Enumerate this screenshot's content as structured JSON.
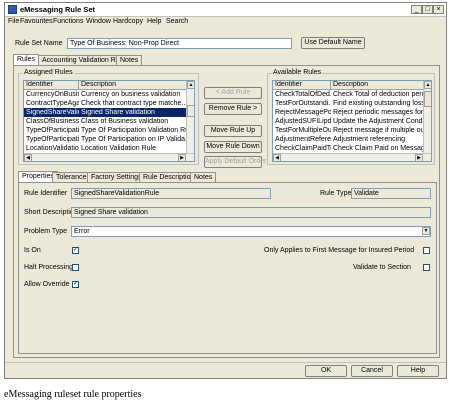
{
  "window": {
    "title": "eMessaging Rule Set",
    "minimize": "_",
    "maximize": "□",
    "close": "×"
  },
  "menu": [
    "File",
    "Favourites",
    "Functions",
    "Window",
    "Hardcopy",
    "Help",
    "Search"
  ],
  "rule_set": {
    "label": "Rule Set Name",
    "value": "Type Of Business: Non-Prop Direct",
    "use_default": "Use Default Name"
  },
  "top_tabs": [
    "Rules",
    "Accounting Validation Rules",
    "Notes"
  ],
  "assigned": {
    "title": "Assigned Rules",
    "headers": [
      "Identifier",
      "Description"
    ],
    "rows": [
      [
        "CurrencyOnBusin...",
        "Currency on business validation"
      ],
      [
        "ContractTypeAgai...",
        "Check that contract type matche..."
      ],
      [
        "SignedShareValida...",
        "Signed Share validation"
      ],
      [
        "ClassOfBusinessO...",
        "Class of Business validation"
      ],
      [
        "TypeOfParticipati...",
        "Type Of Participation Validation Rule"
      ],
      [
        "TypeOfParticipati...",
        "Type Of Participation on IP Valida..."
      ],
      [
        "LocationValidation",
        "Location Validation Rule"
      ]
    ],
    "selected_index": 2
  },
  "actions": {
    "add": "< Add Rule",
    "remove": "Remove Rule >",
    "up": "Move Rule Up",
    "down": "Move Rule Down",
    "apply": "Apply Default Order"
  },
  "available": {
    "title": "Available Rules",
    "headers": [
      "Identifier",
      "Description"
    ],
    "rows": [
      [
        "CheckTotalOfDed...",
        "Check Total of deduction percen"
      ],
      [
        "TestForOutstandi...",
        "Find existing outstanding losses"
      ],
      [
        "RejectMessagePo...",
        "Reject periodic messages for 'hi"
      ],
      [
        "AdjustedSUFILipd...",
        "Update the Adjustment Condition"
      ],
      [
        "TestForMultipleOu...",
        "Reject message if multiple outst"
      ],
      [
        "AdjustmentRefere...",
        "Adjustment referencing"
      ],
      [
        "CheckClaimPaidTo...",
        "Check Claim Paid on Message"
      ]
    ]
  },
  "bottom_tabs": [
    "Properties",
    "Tolerance",
    "Factory Settings",
    "Rule Description",
    "Notes"
  ],
  "properties": {
    "rule_identifier_label": "Rule Identifier",
    "rule_identifier": "SignedShareValidationRule",
    "rule_type_label": "Rule Type",
    "rule_type": "Validate",
    "short_description_label": "Short Description",
    "short_description": "Signed Share validation",
    "problem_type_label": "Problem Type",
    "problem_type": "Error",
    "is_on_label": "Is On",
    "is_on": true,
    "halt_processing_label": "Halt Processing",
    "halt_processing": false,
    "allow_override_label": "Allow Override",
    "allow_override": true,
    "first_message_label": "Only Applies to First Message for Insured Period",
    "first_message": false,
    "validate_section_label": "Validate to Section",
    "validate_section": false
  },
  "footer": {
    "ok": "OK",
    "cancel": "Cancel",
    "help": "Help"
  },
  "caption": "eMessaging ruleset rule properties",
  "colors": {
    "window_bg": "#ece9d8",
    "selection": "#0a246a",
    "field_border": "#7f9db9"
  }
}
